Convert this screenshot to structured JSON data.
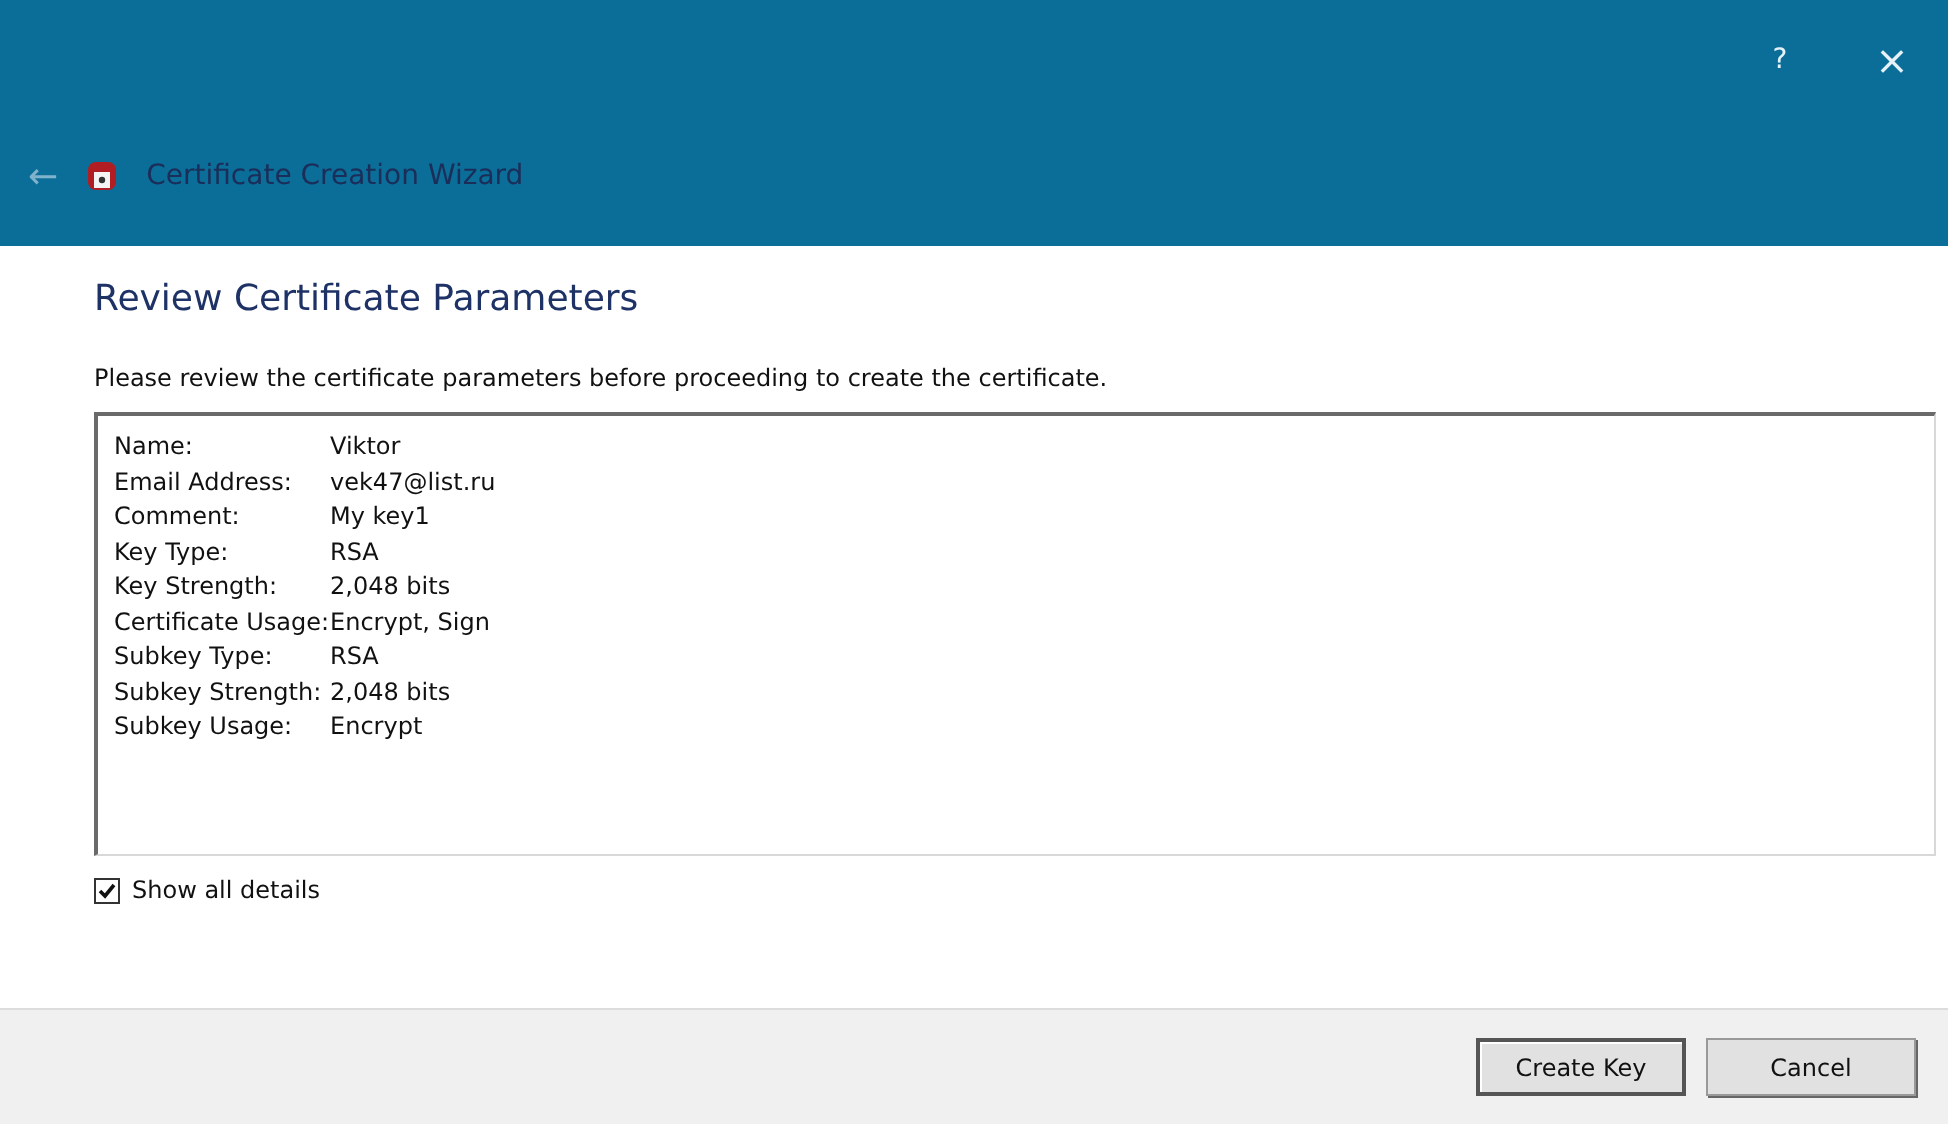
{
  "window": {
    "help": "?",
    "close": "×"
  },
  "wizard": {
    "back": "←",
    "title": "Certificate Creation Wizard"
  },
  "heading": "Review Certificate Parameters",
  "description": "Please review the certificate parameters before proceeding to create the certificate.",
  "parameters": [
    {
      "label": "Name:",
      "value": "Viktor"
    },
    {
      "label": "Email Address:",
      "value": "vek47@list.ru"
    },
    {
      "label": "Comment:",
      "value": "My key1"
    },
    {
      "label": "Key Type:",
      "value": "RSA"
    },
    {
      "label": "Key Strength:",
      "value": "2,048 bits"
    },
    {
      "label": "Certificate Usage:",
      "value": "Encrypt, Sign"
    },
    {
      "label": "Subkey Type:",
      "value": "RSA"
    },
    {
      "label": "Subkey Strength:",
      "value": "2,048 bits"
    },
    {
      "label": "Subkey Usage:",
      "value": "Encrypt"
    }
  ],
  "show_all_details": {
    "label": "Show all details",
    "checked": true
  },
  "buttons": [
    {
      "label": "Create Key",
      "default": true
    },
    {
      "label": "Cancel",
      "default": false
    }
  ]
}
